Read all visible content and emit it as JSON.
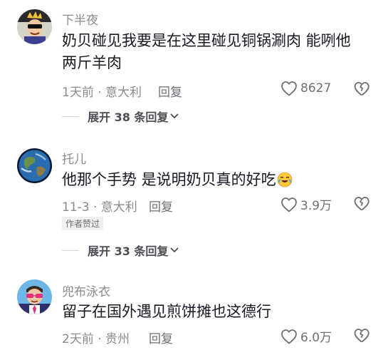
{
  "comments": [
    {
      "username": "下半夜",
      "avatar_icon": "cartoon-character-avatar",
      "text": "奶贝碰见我要是在这里碰见铜锅涮肉 能咧他两斤羊肉",
      "meta": "1天前 · 意大利",
      "reply_label": "回复",
      "likes": "8627",
      "expand_label": "展开 38 条回复"
    },
    {
      "username": "托儿",
      "avatar_icon": "earth-globe-avatar",
      "text": "他那个手势 是说明奶贝真的好吃",
      "emoji": "crying-laughing-emoji",
      "meta": "11-3 · 意大利",
      "reply_label": "回复",
      "likes": "3.9万",
      "author_badge": "作者赞过",
      "expand_label": "展开 33 条回复"
    },
    {
      "username": "兜布泳衣",
      "avatar_icon": "cartoon-sunglasses-avatar",
      "text": "留子在国外遇见煎饼摊也这德行",
      "meta": "2天前 · 贵州",
      "reply_label": "回复",
      "likes": "6.0万"
    }
  ],
  "colors": {
    "primary_text": "#161823",
    "secondary_text": "#8a8b91",
    "badge_bg": "#f1f1f2"
  }
}
